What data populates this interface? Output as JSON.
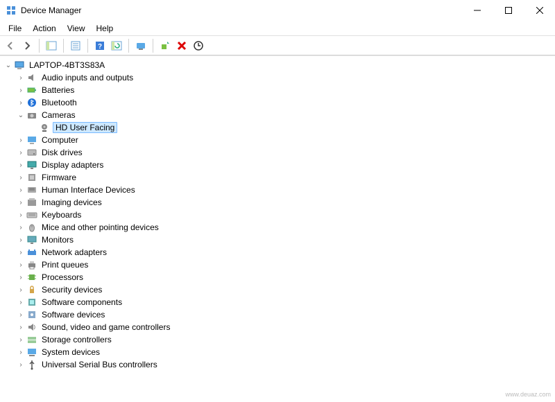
{
  "window": {
    "title": "Device Manager"
  },
  "menu": {
    "file": "File",
    "action": "Action",
    "view": "View",
    "help": "Help"
  },
  "toolbar": {
    "back": "Back",
    "forward": "Forward",
    "show_hide": "Show/Hide Console Tree",
    "properties": "Properties",
    "help": "Help",
    "refresh": "Refresh",
    "view_devices": "View",
    "update": "Update Driver",
    "uninstall": "Uninstall Device",
    "scan": "Scan for hardware changes"
  },
  "tree": {
    "root": "LAPTOP-4BT3S83A",
    "items": [
      {
        "label": "Audio inputs and outputs",
        "icon": "audio",
        "expanded": false
      },
      {
        "label": "Batteries",
        "icon": "battery",
        "expanded": false
      },
      {
        "label": "Bluetooth",
        "icon": "bluetooth",
        "expanded": false
      },
      {
        "label": "Cameras",
        "icon": "camera",
        "expanded": true,
        "children": [
          {
            "label": "HD User Facing",
            "icon": "webcam",
            "selected": true
          }
        ]
      },
      {
        "label": "Computer",
        "icon": "computer",
        "expanded": false
      },
      {
        "label": "Disk drives",
        "icon": "disk",
        "expanded": false
      },
      {
        "label": "Display adapters",
        "icon": "display",
        "expanded": false
      },
      {
        "label": "Firmware",
        "icon": "firmware",
        "expanded": false
      },
      {
        "label": "Human Interface Devices",
        "icon": "hid",
        "expanded": false
      },
      {
        "label": "Imaging devices",
        "icon": "imaging",
        "expanded": false
      },
      {
        "label": "Keyboards",
        "icon": "keyboard",
        "expanded": false
      },
      {
        "label": "Mice and other pointing devices",
        "icon": "mouse",
        "expanded": false
      },
      {
        "label": "Monitors",
        "icon": "monitor",
        "expanded": false
      },
      {
        "label": "Network adapters",
        "icon": "network",
        "expanded": false
      },
      {
        "label": "Print queues",
        "icon": "printer",
        "expanded": false
      },
      {
        "label": "Processors",
        "icon": "cpu",
        "expanded": false
      },
      {
        "label": "Security devices",
        "icon": "security",
        "expanded": false
      },
      {
        "label": "Software components",
        "icon": "softcomp",
        "expanded": false
      },
      {
        "label": "Software devices",
        "icon": "softdev",
        "expanded": false
      },
      {
        "label": "Sound, video and game controllers",
        "icon": "sound",
        "expanded": false
      },
      {
        "label": "Storage controllers",
        "icon": "storage",
        "expanded": false
      },
      {
        "label": "System devices",
        "icon": "system",
        "expanded": false
      },
      {
        "label": "Universal Serial Bus controllers",
        "icon": "usb",
        "expanded": false
      }
    ]
  },
  "watermark": "www.deuaz.com"
}
